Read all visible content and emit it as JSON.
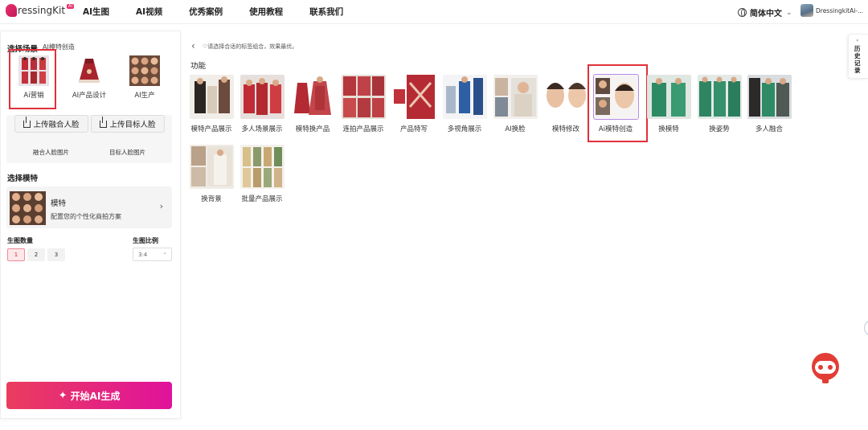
{
  "header": {
    "logo_text": "ressingKit",
    "logo_badge": "AI",
    "nav": [
      "AI生图",
      "AI视频",
      "优秀案例",
      "使用教程",
      "联系我们"
    ],
    "language": "简体中文",
    "user_name": "DressingkitAi-..."
  },
  "left": {
    "scene_title": "选择场景",
    "scene_subtitle": "AI模特创造",
    "scenes": [
      {
        "label": "Ai营销"
      },
      {
        "label": "AI产品设计"
      },
      {
        "label": "AI生产"
      }
    ],
    "upload_face_merge": "上传融合人脸",
    "upload_target_face": "上传目标人脸",
    "hint_merge": "融合人脸图片",
    "hint_target": "目标人脸图片",
    "model_title": "选择模特",
    "model_card_title": "模特",
    "model_card_desc": "配置您的个性化商拍方案",
    "count_label": "生图数量",
    "count_options": [
      "1",
      "2",
      "3"
    ],
    "ratio_label": "生图比例",
    "ratio_value": "3:4",
    "generate_button": "开始AI生成"
  },
  "main": {
    "tip": "请选择合适的标签组合，效果最优。",
    "func_title": "功能",
    "functions": [
      {
        "label": "模特产品展示"
      },
      {
        "label": "多人场景展示"
      },
      {
        "label": "模特换产品"
      },
      {
        "label": "连拍产品展示"
      },
      {
        "label": "产品特写"
      },
      {
        "label": "多视角展示"
      },
      {
        "label": "AI换脸"
      },
      {
        "label": "模特修改"
      },
      {
        "label": "Ai模特创造"
      },
      {
        "label": "换模特"
      },
      {
        "label": "换姿势"
      },
      {
        "label": "多人融合"
      },
      {
        "label": "换背景"
      },
      {
        "label": "批量产品展示"
      }
    ]
  },
  "history": {
    "label": "历史记录",
    "collapse": "«"
  },
  "colors": {
    "accent_red": "#e0303a",
    "gradient_start": "#ea3d5e",
    "gradient_end": "#e0129b"
  }
}
